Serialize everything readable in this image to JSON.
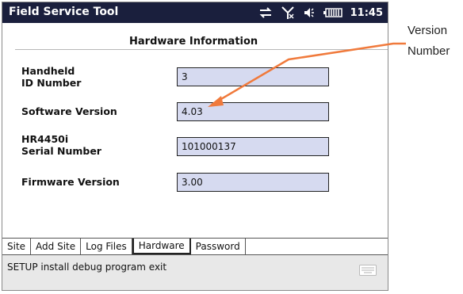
{
  "window": {
    "title": "Field Service Tool",
    "clock": "11:45",
    "status_icons": [
      "connectivity-icon",
      "signal-off-icon",
      "volume-icon",
      "battery-icon"
    ]
  },
  "section": {
    "title": "Hardware Information"
  },
  "fields": [
    {
      "label_line1": "Handheld",
      "label_line2": "ID Number",
      "value": "3"
    },
    {
      "label_line1": "Software Version",
      "label_line2": "",
      "value": "4.03"
    },
    {
      "label_line1": "HR4450i",
      "label_line2": "Serial Number",
      "value": "101000137"
    },
    {
      "label_line1": "Firmware Version",
      "label_line2": "",
      "value": "3.00"
    }
  ],
  "tabs": [
    {
      "label": "Site",
      "active": false
    },
    {
      "label": "Add Site",
      "active": false
    },
    {
      "label": "Log Files",
      "active": false
    },
    {
      "label": "Hardware",
      "active": true
    },
    {
      "label": "Password",
      "active": false
    }
  ],
  "command_bar": {
    "text": "SETUP install debug program exit",
    "icon": "keyboard-icon"
  },
  "annotation": {
    "line1": "Version",
    "line2": "Number",
    "arrow_color": "#f07a3c"
  },
  "colors": {
    "titlebar": "#1a1f3d",
    "field_bg": "#d6daf0",
    "command_bar": "#e8e8e8"
  }
}
